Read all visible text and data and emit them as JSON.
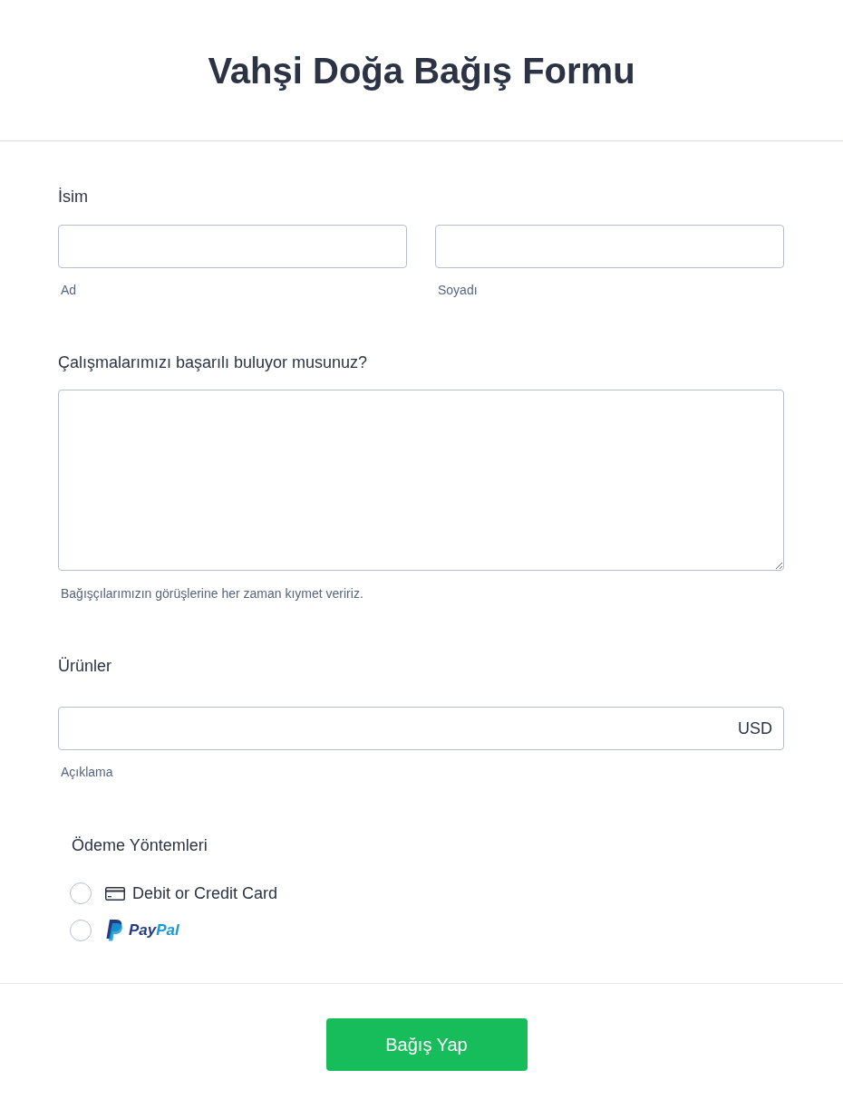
{
  "header": {
    "title": "Vahşi Doğa Bağış Formu"
  },
  "fields": [
    {
      "kind": "name",
      "label": "İsim",
      "inputs": [
        {
          "sublabel": "Ad"
        },
        {
          "sublabel": "Soyadı"
        }
      ]
    },
    {
      "kind": "textarea",
      "label": "Çalışmalarımızı başarılı buluyor musunuz?",
      "sublabel": "Bağışçılarımızın görüşlerine her zaman kıymet veririz."
    },
    {
      "kind": "amount",
      "label": "Ürünler",
      "currency": "USD",
      "sublabel": "Açıklama"
    }
  ],
  "payment": {
    "label": "Ödeme Yöntemleri",
    "options": [
      {
        "kind": "card",
        "label": "Debit or Credit Card",
        "selected": false
      },
      {
        "kind": "paypal",
        "label_parts": [
          "Pay",
          "Pal"
        ],
        "selected": false
      }
    ]
  },
  "submit": {
    "label": "Bağış Yap"
  }
}
